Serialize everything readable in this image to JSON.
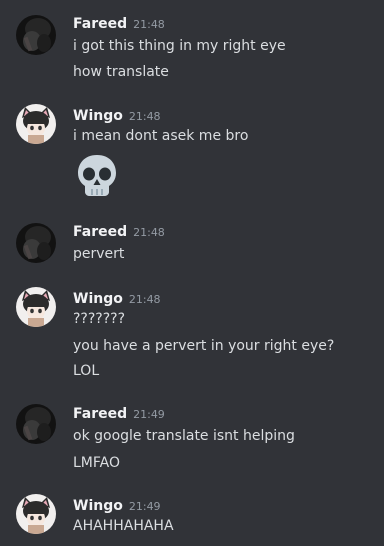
{
  "messages": [
    {
      "author": "Fareed",
      "time": "21:48",
      "lines": [
        "i got this thing in my right eye",
        "how translate"
      ]
    },
    {
      "author": "Wingo",
      "time": "21:48",
      "lines": [
        "i mean dont asek me bro"
      ],
      "emoji": "skull-emoji"
    },
    {
      "author": "Fareed",
      "time": "21:48",
      "lines": [
        "pervert"
      ]
    },
    {
      "author": "Wingo",
      "time": "21:48",
      "lines": [
        "???????",
        "you have a pervert in your right eye?",
        "LOL"
      ]
    },
    {
      "author": "Fareed",
      "time": "21:49",
      "lines": [
        "ok google translate isnt helping",
        "LMFAO"
      ]
    },
    {
      "author": "Wingo",
      "time": "21:49",
      "lines": [
        "AHAHHAHAHA"
      ]
    }
  ],
  "colors": {
    "background": "#313338",
    "username": "#f2f3f5",
    "timestamp": "#949ba4",
    "message_text": "#dbdee1"
  }
}
